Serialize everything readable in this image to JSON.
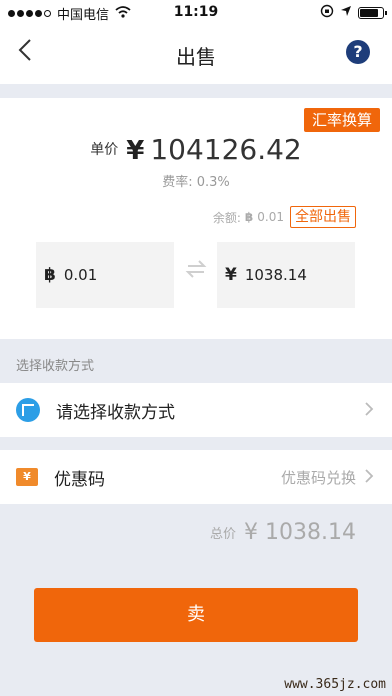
{
  "status_bar": {
    "carrier": "中国电信",
    "time": "11:19"
  },
  "nav": {
    "title": "出售",
    "back_icon": "chevron-left-icon",
    "help_icon": "question-icon",
    "help_label": "?"
  },
  "card": {
    "rate_button": "汇率换算",
    "price_label": "单价",
    "currency_symbol": "¥",
    "price": "104126.42",
    "fee": "费率: 0.3%",
    "balance_label": "余额:",
    "balance_symbol": "฿",
    "balance_value": "0.01",
    "sell_all": "全部出售",
    "btc_symbol": "฿",
    "btc_amount": "0.01",
    "cny_symbol": "¥",
    "cny_amount": "1038.14"
  },
  "payment_section": {
    "header": "选择收款方式",
    "label": "请选择收款方式"
  },
  "coupon": {
    "icon_text": "¥",
    "label": "优惠码",
    "hint": "优惠码兑换"
  },
  "total": {
    "label": "总价",
    "value": "¥ 1038.14"
  },
  "sell_button": "卖",
  "watermark": "www.365jz.com",
  "colors": {
    "accent": "#f0660b",
    "help_icon": "#1e3d7a",
    "payment_icon": "#2c9ee6"
  }
}
